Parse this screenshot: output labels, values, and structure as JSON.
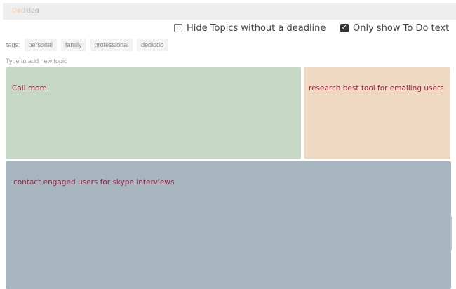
{
  "app": {
    "logo_letters": [
      "D",
      "e",
      "d",
      "i",
      "d",
      "d",
      "o"
    ],
    "logo_colors": [
      "#f6d2a8",
      "#f3c8a8",
      "#e9c1b9",
      "#c9d7c6",
      "#b8c7cf",
      "#a7b4bf",
      "#9aa6ae"
    ]
  },
  "filters": {
    "hide_without_deadline": {
      "label": "Hide Topics without a deadline",
      "checked": false
    },
    "only_todo": {
      "label": "Only show To Do text",
      "checked": true
    }
  },
  "tags": {
    "label": "tags:",
    "items": [
      "personal",
      "family",
      "professional",
      "dediddo"
    ]
  },
  "new_topic": {
    "placeholder": "Type to add new topic",
    "value": ""
  },
  "topics": [
    {
      "title": "Call mom",
      "color": "#c7d8c7"
    },
    {
      "title": "research best tool for emailing users",
      "color": "#f0d9c3"
    },
    {
      "title": "contact engaged users for skype interviews",
      "color": "#a7b5bf"
    }
  ],
  "text_color": "#a0214a"
}
